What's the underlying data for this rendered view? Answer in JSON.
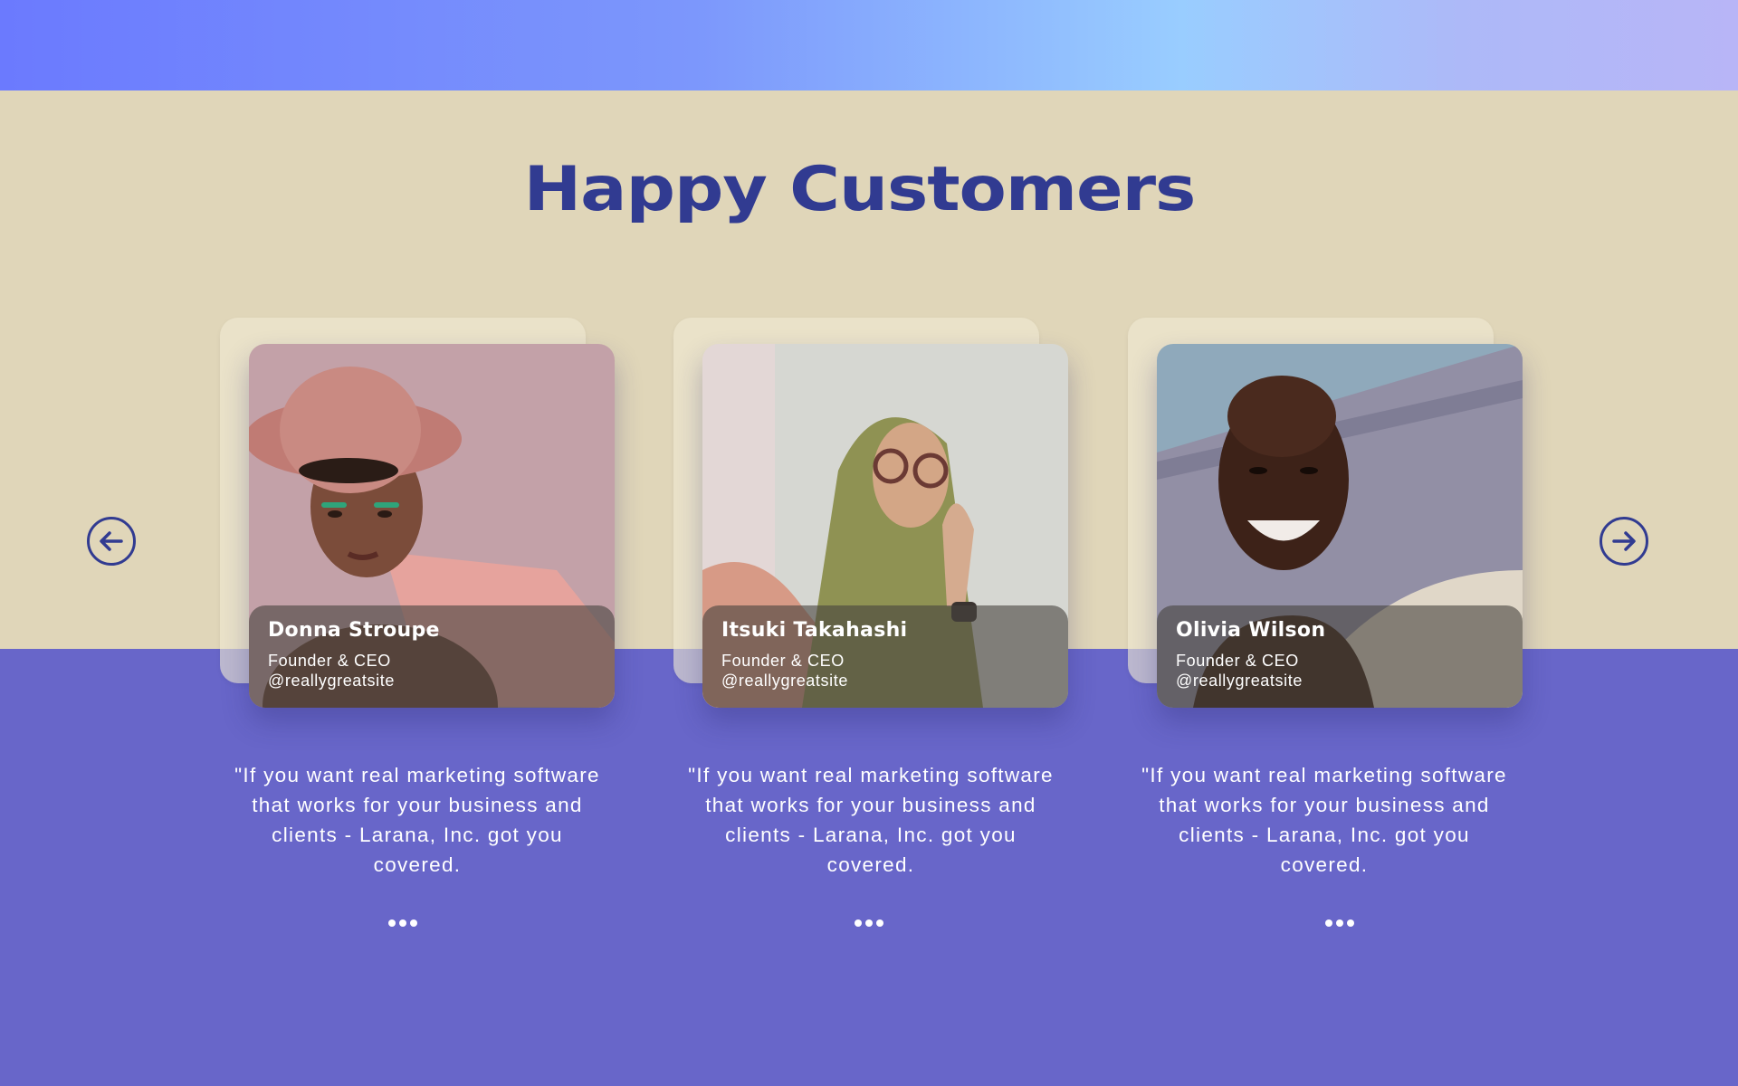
{
  "page": {
    "title": "Happy Customers"
  },
  "nav": {
    "prev_icon": "arrow-left-circle-icon",
    "next_icon": "arrow-right-circle-icon"
  },
  "testimonials": [
    {
      "name": "Donna Stroupe",
      "role": "Founder & CEO",
      "handle": "@reallygreatsite",
      "quote": "\"If you want real marketing software that works for your business and clients - Larana, Inc. got you covered."
    },
    {
      "name": "Itsuki Takahashi",
      "role": "Founder & CEO",
      "handle": "@reallygreatsite",
      "quote": "\"If you want real marketing software that works for your business and clients - Larana, Inc. got you covered."
    },
    {
      "name": "Olivia Wilson",
      "role": "Founder & CEO",
      "handle": "@reallygreatsite",
      "quote": "\"If you want real marketing software that works for your business and clients - Larana, Inc. got you covered."
    }
  ],
  "colors": {
    "title": "#313b91",
    "cream": "#e0d6b9",
    "purple": "#6866c9"
  }
}
